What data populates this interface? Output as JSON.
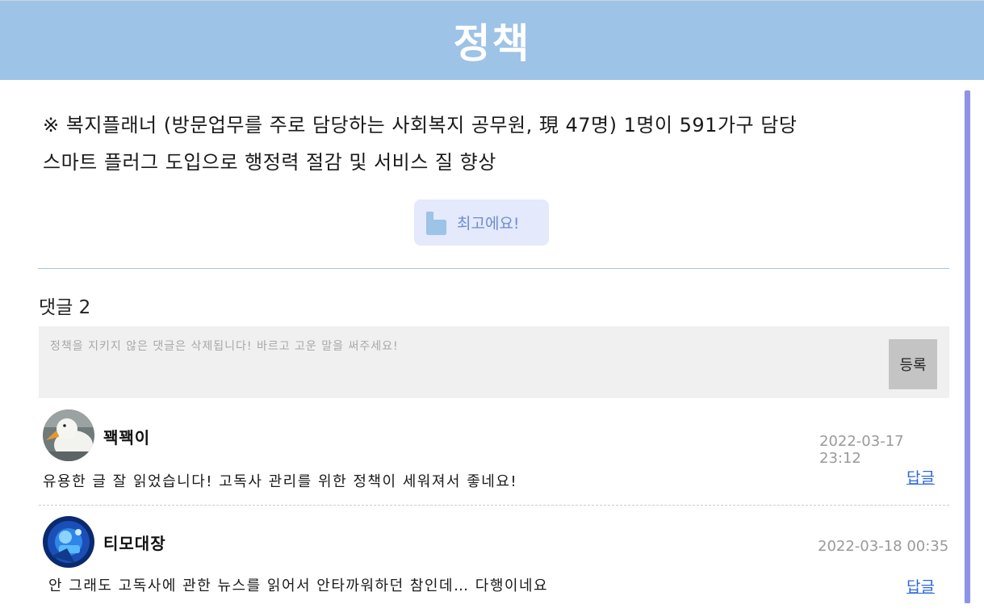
{
  "header": {
    "title": "정책"
  },
  "notice": {
    "line1": "※ 복지플래너 (방문업무를 주로 담당하는 사회복지 공무원, 現 47명) 1명이 591가구 담당",
    "line2": "스마트 플러그 도입으로 행정력 절감 및 서비스 질 향상"
  },
  "like_button": {
    "icon": "thumbs-up-icon",
    "label": "최고에요!"
  },
  "comments": {
    "title": "댓글 2",
    "input_placeholder": "정책을 지키지 않은 댓글은 삭제됩니다! 바르고 고운 말을 써주세요!",
    "submit_label": "등록",
    "items": [
      {
        "author": "꽥꽥이",
        "avatar": "duck-avatar",
        "timestamp": "2022-03-17 23:12",
        "text": "유용한 글 잘 읽었습니다! 고독사 관리를 위한 정책이 세워져서 좋네요!",
        "reply_label": "답글"
      },
      {
        "author": "티모대장",
        "avatar": "game-character-avatar",
        "timestamp": "2022-03-18 00:35",
        "text": "안 그래도 고독사에 관한 뉴스를 읽어서 안타까워하던 참인데… 다행이네요",
        "reply_label": "답글"
      }
    ]
  },
  "colors": {
    "header_bg": "#9dc3e6",
    "like_bg": "#e4e9fb",
    "like_text": "#6d8dd0",
    "link": "#2d66e0",
    "scrollbar": "#8f93e6"
  }
}
